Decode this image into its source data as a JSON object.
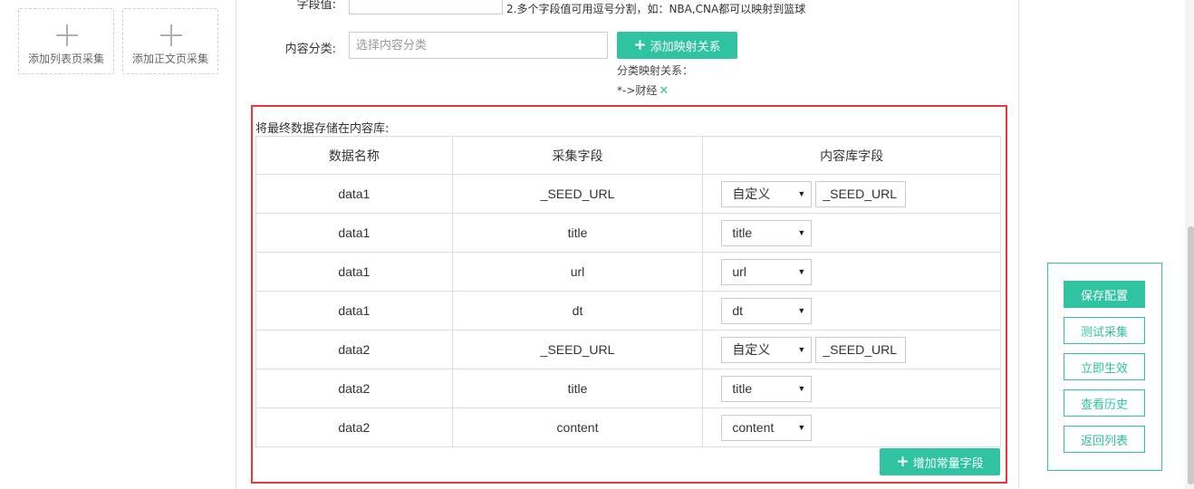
{
  "left_panel": {
    "add_list_label": "添加列表页采集",
    "add_body_label": "添加正文页采集"
  },
  "form": {
    "field_value_label": "字段值:",
    "field_value_input": "",
    "field_value_hint": "2.多个字段值可用逗号分割，如：NBA,CNA都可以映射到篮球",
    "category_label": "内容分类:",
    "category_placeholder": "选择内容分类",
    "add_mapping_button": "添加映射关系",
    "mapping_label": "分类映射关系：",
    "mapping_item": "*->财经"
  },
  "storage": {
    "label": "将最终数据存储在内容库:",
    "columns": [
      "数据名称",
      "采集字段",
      "内容库字段"
    ],
    "rows": [
      {
        "name": "data1",
        "field": "_SEED_URL",
        "select": "自定义",
        "custom": "_SEED_URL"
      },
      {
        "name": "data1",
        "field": "title",
        "select": "title",
        "custom": null
      },
      {
        "name": "data1",
        "field": "url",
        "select": "url",
        "custom": null
      },
      {
        "name": "data1",
        "field": "dt",
        "select": "dt",
        "custom": null
      },
      {
        "name": "data2",
        "field": "_SEED_URL",
        "select": "自定义",
        "custom": "_SEED_URL"
      },
      {
        "name": "data2",
        "field": "title",
        "select": "title",
        "custom": null
      },
      {
        "name": "data2",
        "field": "content",
        "select": "content",
        "custom": null
      }
    ],
    "add_const_button": "增加常量字段"
  },
  "side_panel": {
    "save": "保存配置",
    "test": "测试采集",
    "apply": "立即生效",
    "history": "查看历史",
    "back": "返回列表"
  },
  "colors": {
    "accent": "#2fc3a2",
    "highlight_border": "#e43b3b"
  }
}
